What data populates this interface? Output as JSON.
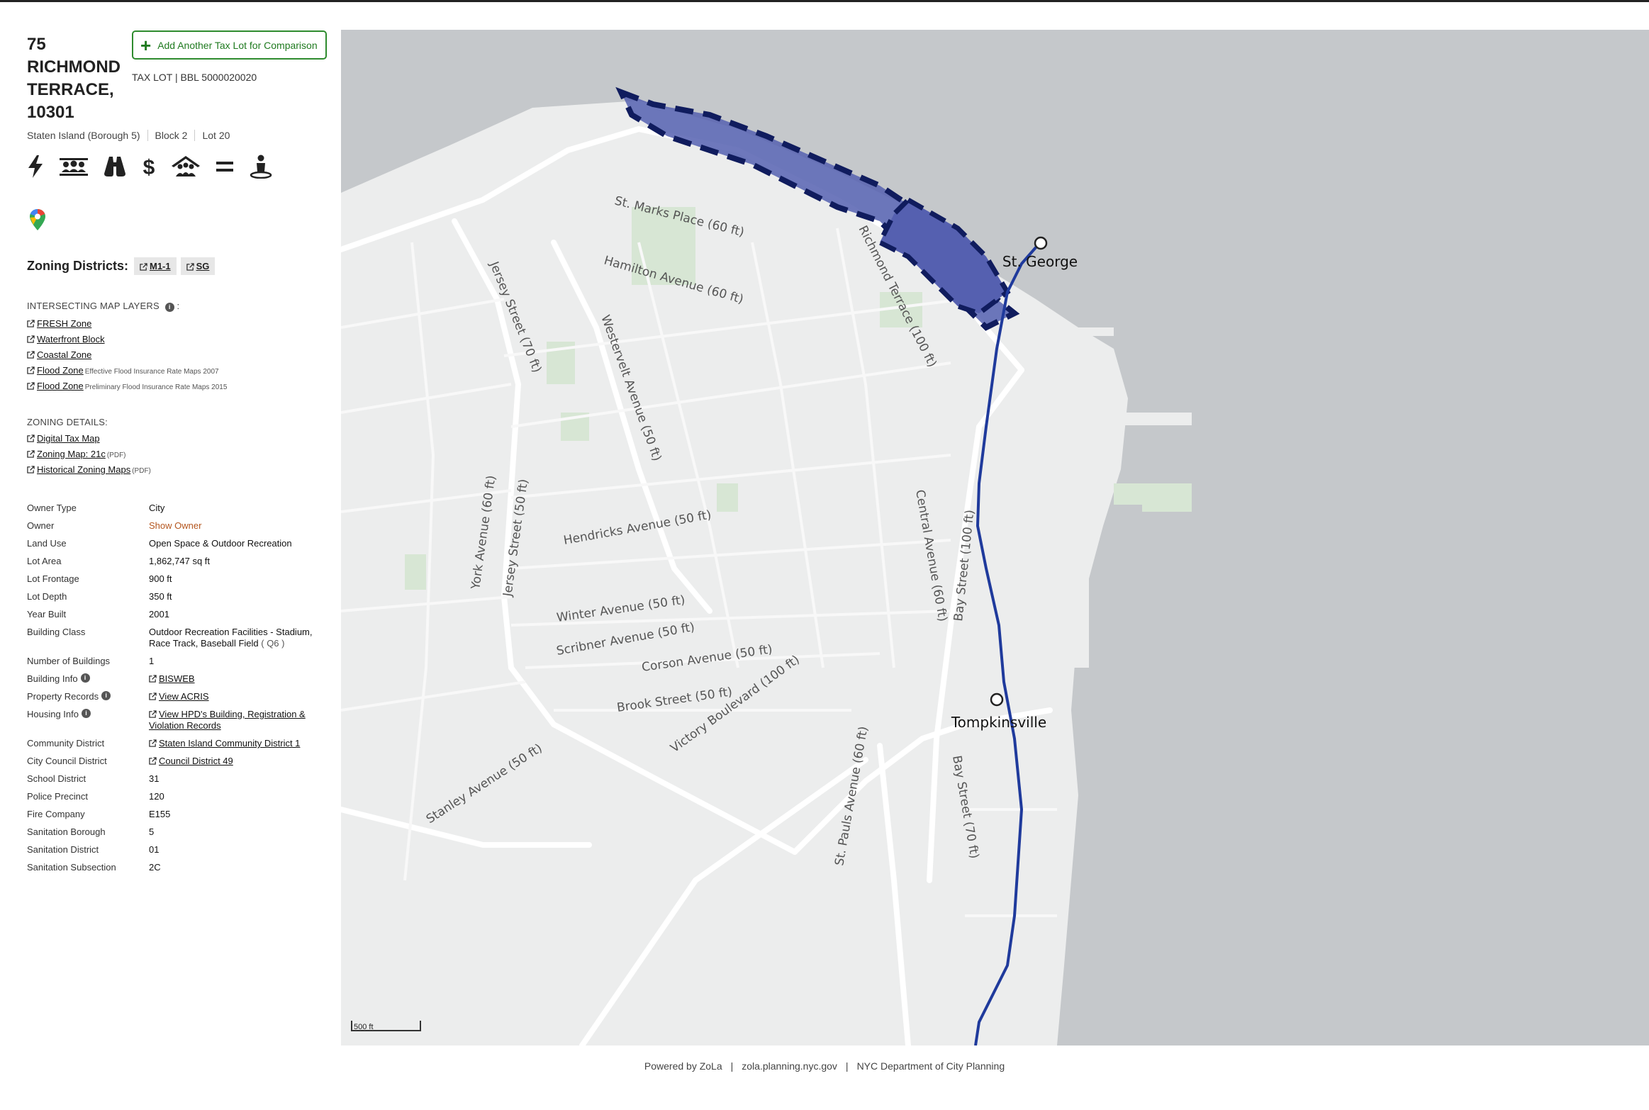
{
  "lot": {
    "title": "75 RICHMOND TERRACE, 10301",
    "compare_button": "Add Another Tax Lot for Comparison",
    "bbl": "TAX LOT | BBL 5000020020",
    "borough": "Staten Island (Borough 5)",
    "block": "Block 2",
    "lot": "Lot 20"
  },
  "icons": [
    "lightning-icon",
    "community-icon",
    "binoculars-icon",
    "dollar-icon",
    "housing-icon",
    "equals-icon",
    "person-icon"
  ],
  "zoning": {
    "label": "Zoning Districts:",
    "districts": [
      "M1-1",
      "SG"
    ]
  },
  "layers": {
    "heading": "INTERSECTING MAP LAYERS",
    "heading_suffix": ":",
    "items": [
      {
        "label": "FRESH Zone",
        "note": ""
      },
      {
        "label": "Waterfront Block",
        "note": ""
      },
      {
        "label": "Coastal Zone",
        "note": ""
      },
      {
        "label": "Flood Zone",
        "note": "Effective Flood Insurance Rate Maps 2007"
      },
      {
        "label": "Flood Zone",
        "note": "Preliminary Flood Insurance Rate Maps 2015"
      }
    ]
  },
  "zoning_details": {
    "heading": "ZONING DETAILS:",
    "items": [
      {
        "label": "Digital Tax Map",
        "note": ""
      },
      {
        "label": "Zoning Map: 21c",
        "note": "(PDF)"
      },
      {
        "label": "Historical Zoning Maps",
        "note": "(PDF)"
      }
    ]
  },
  "properties": {
    "owner_type": {
      "k": "Owner Type",
      "v": "City"
    },
    "owner": {
      "k": "Owner",
      "v": "Show Owner"
    },
    "land_use": {
      "k": "Land Use",
      "v": "Open Space & Outdoor Recreation"
    },
    "lot_area": {
      "k": "Lot Area",
      "v": "1,862,747 sq ft"
    },
    "lot_frontage": {
      "k": "Lot Frontage",
      "v": "900 ft"
    },
    "lot_depth": {
      "k": "Lot Depth",
      "v": "350 ft"
    },
    "year_built": {
      "k": "Year Built",
      "v": "2001"
    },
    "building_class": {
      "k": "Building Class",
      "v": "Outdoor Recreation Facilities - Stadium, Race Track, Baseball Field",
      "code": "( Q6 )"
    },
    "num_buildings": {
      "k": "Number of Buildings",
      "v": "1"
    },
    "building_info": {
      "k": "Building Info",
      "v": "BISWEB"
    },
    "property_records": {
      "k": "Property Records",
      "v": "View ACRIS"
    },
    "housing_info": {
      "k": "Housing Info",
      "v": "View HPD's Building, Registration & Violation Records"
    },
    "community_district": {
      "k": "Community District",
      "v": "Staten Island Community District 1"
    },
    "council_district": {
      "k": "City Council District",
      "v": "Council District 49"
    },
    "school_district": {
      "k": "School District",
      "v": "31"
    },
    "police_precinct": {
      "k": "Police Precinct",
      "v": "120"
    },
    "fire_company": {
      "k": "Fire Company",
      "v": "E155"
    },
    "sanitation_borough": {
      "k": "Sanitation Borough",
      "v": "5"
    },
    "sanitation_district": {
      "k": "Sanitation District",
      "v": "01"
    },
    "sanitation_subsection": {
      "k": "Sanitation Subsection",
      "v": "2C"
    }
  },
  "map": {
    "scale": "500 ft",
    "stations": [
      "St. George",
      "Tompkinsville"
    ],
    "streets": {
      "st_marks": "St. Marks Place  (60 ft)",
      "hamilton": "Hamilton Avenue  (60 ft)",
      "richmond": "Richmond Terrace  (100 ft)",
      "jersey1": "Jersey Street  (70 ft)",
      "westervelt": "Westervelt Avenue  (50 ft)",
      "york": "York Avenue  (60 ft)",
      "jersey2": "Jersey Street  (50 ft)",
      "hendricks": "Hendricks Avenue  (50 ft)",
      "winter": "Winter Avenue  (50 ft)",
      "scribner": "Scribner Avenue  (50 ft)",
      "corson": "Corson Avenue  (50 ft)",
      "brook": "Brook Street  (50 ft)",
      "victory": "Victory Boulevard  (100 ft)",
      "stanley": "Stanley Avenue  (50 ft)",
      "central": "Central Avenue  (60 ft)",
      "bay1": "Bay Street  (100 ft)",
      "bay2": "Bay Street  (70 ft)",
      "st_pauls": "St. Pauls Avenue  (60 ft)"
    }
  },
  "footer": {
    "powered": "Powered by ZoLa",
    "site": "zola.planning.nyc.gov",
    "org": "NYC Department of City Planning"
  }
}
